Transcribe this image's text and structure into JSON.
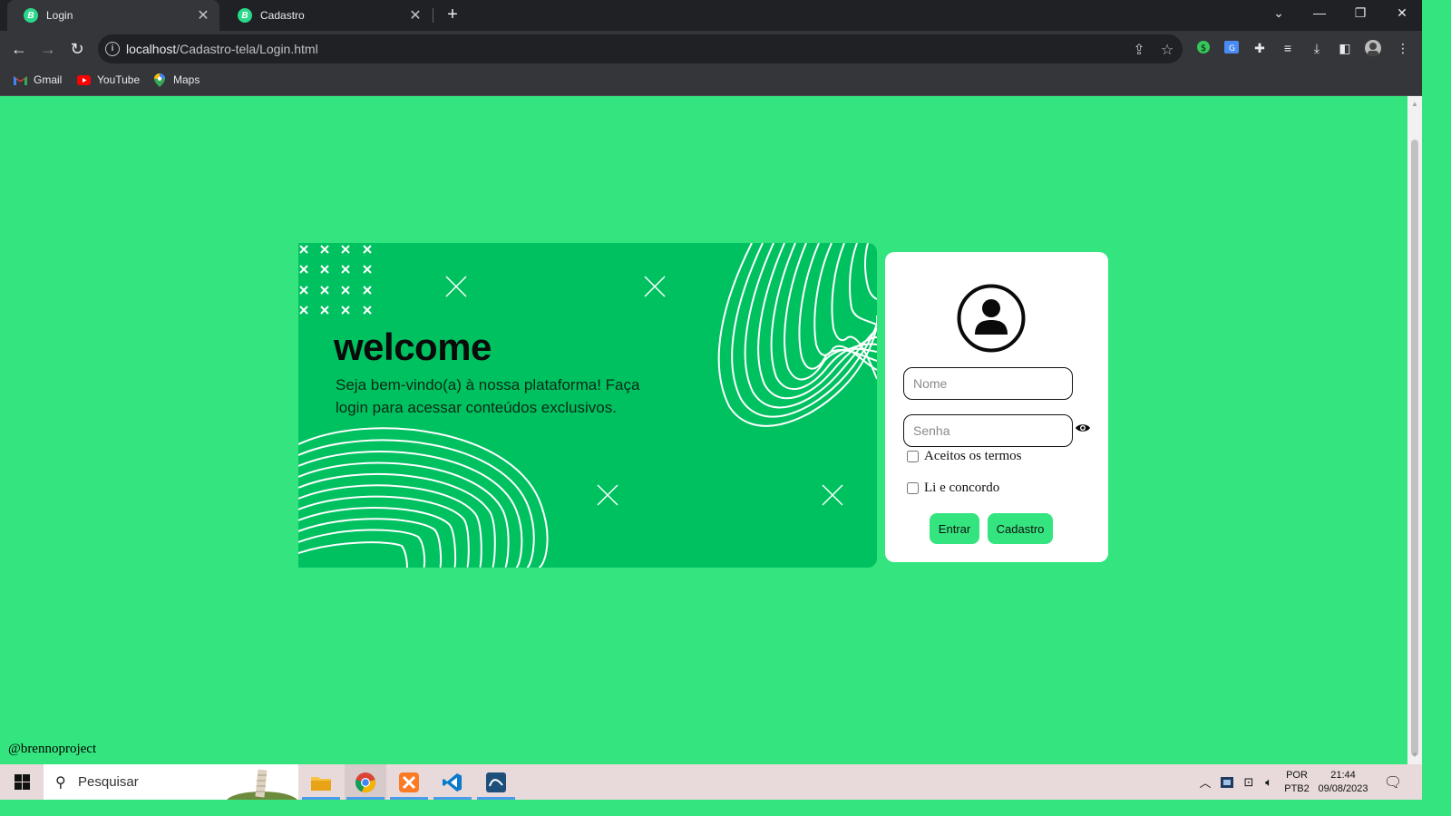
{
  "browser": {
    "tabs": [
      {
        "title": "Login",
        "favicon": "B",
        "active": true
      },
      {
        "title": "Cadastro",
        "favicon": "B",
        "active": false
      }
    ],
    "url_host": "localhost",
    "url_path": "/Cadastro-tela/Login.html",
    "bookmarks": [
      {
        "label": "Gmail",
        "icon": "gmail-icon"
      },
      {
        "label": "YouTube",
        "icon": "youtube-icon"
      },
      {
        "label": "Maps",
        "icon": "maps-icon"
      }
    ]
  },
  "banner": {
    "heading": "welcome",
    "text": "Seja bem-vindo(a) à nossa plataforma! Faça login para acessar conteúdos exclusivos."
  },
  "form": {
    "name_placeholder": "Nome",
    "password_placeholder": "Senha",
    "terms_label": "Aceitos os termos",
    "agree_label": "Li e concordo",
    "enter_label": "Entrar",
    "signup_label": "Cadastro"
  },
  "footer": {
    "credit": "@brennoproject"
  },
  "taskbar": {
    "search_placeholder": "Pesquisar",
    "lang_top": "POR",
    "lang_bottom": "PTB2",
    "time": "21:44",
    "date": "09/08/2023"
  },
  "colors": {
    "page_bg": "#34e57f",
    "banner_bg": "#00c160",
    "card_bg": "#ffffff",
    "button_bg": "#34e57f"
  }
}
